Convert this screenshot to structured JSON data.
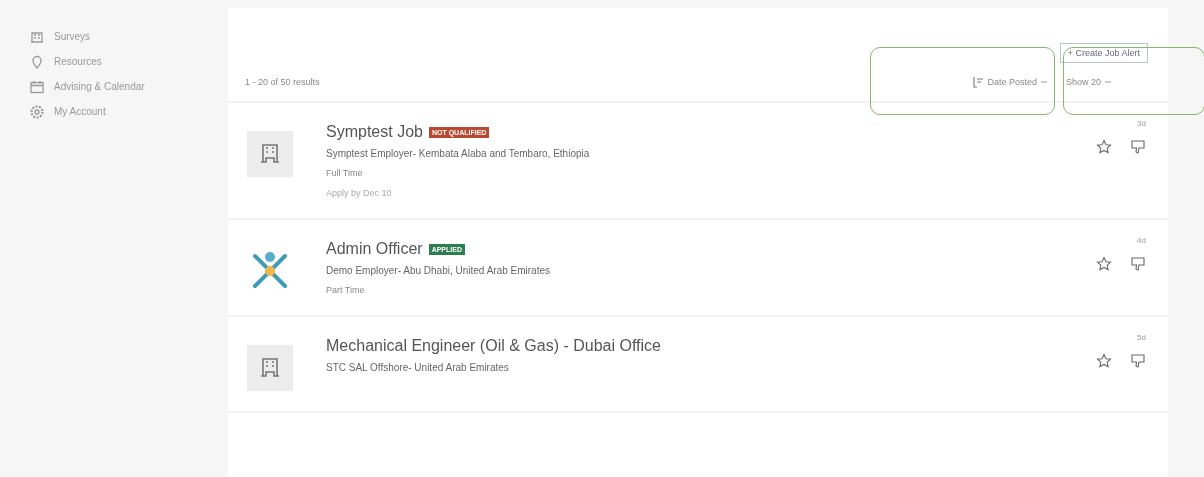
{
  "sidebar": {
    "items": [
      {
        "label": "Surveys"
      },
      {
        "label": "Resources"
      },
      {
        "label": "Advising & Calendar"
      },
      {
        "label": "My Account"
      }
    ]
  },
  "toolbar": {
    "create_alert": "+ Create Job Alert",
    "results": "1 - 20 of 50 results",
    "sort": {
      "label": "Date Posted",
      "highlighted": true
    },
    "show": {
      "label": "Show 20",
      "highlighted": true
    }
  },
  "jobs": [
    {
      "title": "Symptest Job",
      "badge": {
        "label": "NOT QUALIFIED",
        "kind": "not_qualified"
      },
      "employer": "Symptest Employer- Kembata Alaba and Tembaro, Ethiopia",
      "type": "Full Time",
      "apply_by": "Apply by Dec 10",
      "age": "3d",
      "kind": "building"
    },
    {
      "title": "Admin Officer",
      "badge": {
        "label": "APPLIED",
        "kind": "applied"
      },
      "employer": "Demo Employer- Abu Dhabi, United Arab Emirates",
      "type": "Part Time",
      "age": "4d",
      "kind": "figure"
    },
    {
      "title": "Mechanical Engineer (Oil & Gas) - Dubai Office",
      "employer": "STC SAL Offshore- United Arab Emirates",
      "age": "5d",
      "kind": "building"
    }
  ]
}
